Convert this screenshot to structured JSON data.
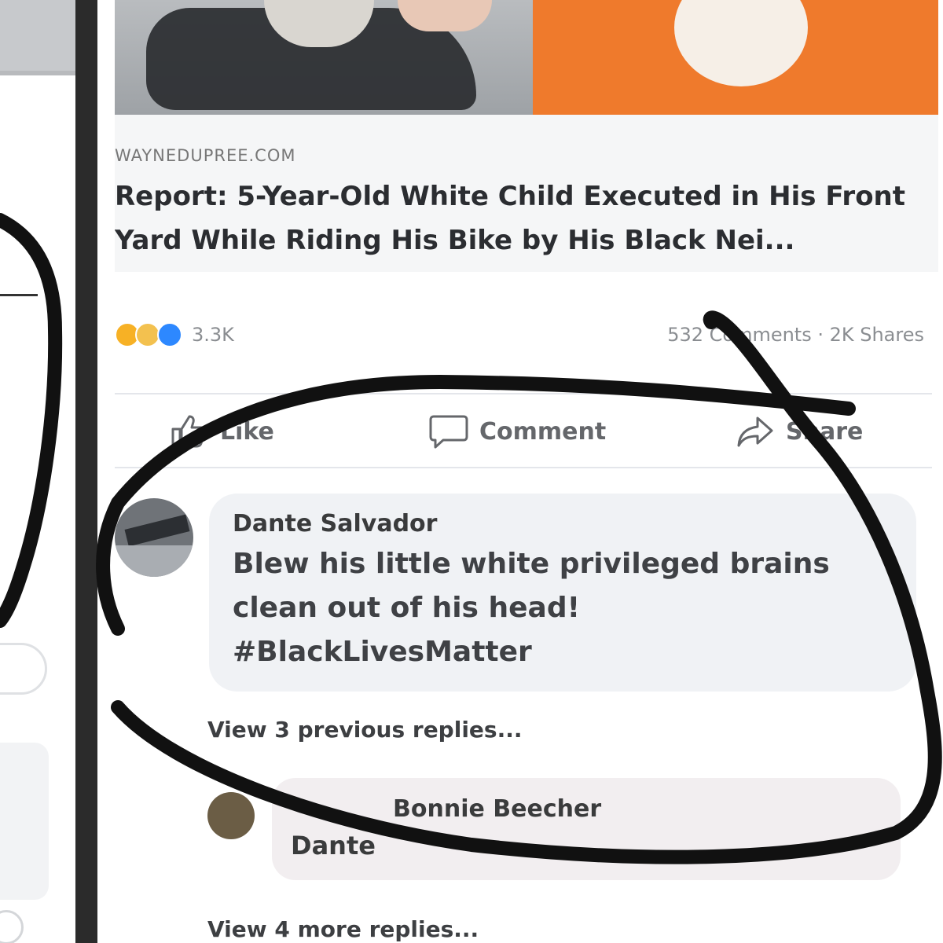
{
  "link_preview": {
    "domain": "WAYNEDUPREE.COM",
    "title": "Report: 5-Year-Old White Child Executed in His Front Yard While Riding His Bike by His Black Nei..."
  },
  "reactions": {
    "count": "3.3K",
    "comments_shares": "532 Comments · 2K Shares"
  },
  "actions": {
    "like_label": "Like",
    "comment_label": "Comment",
    "share_label": "Share"
  },
  "comment": {
    "author": "Dante Salvador",
    "text": "Blew his little white privileged brains\nclean out of his head!\n#BlackLivesMatter"
  },
  "view_previous_replies": "View 3 previous replies...",
  "reply": {
    "author": "Bonnie Beecher",
    "text": "Dante"
  },
  "view_more_replies": "View 4 more replies...",
  "colors": {
    "brand_blue": "#2d88ff",
    "annotation_ink": "#111111",
    "image_orange": "#ef7a2c"
  },
  "icons": [
    "like-icon",
    "comment-icon",
    "share-icon",
    "haha-reaction-icon",
    "sad-reaction-icon",
    "like-reaction-icon"
  ]
}
